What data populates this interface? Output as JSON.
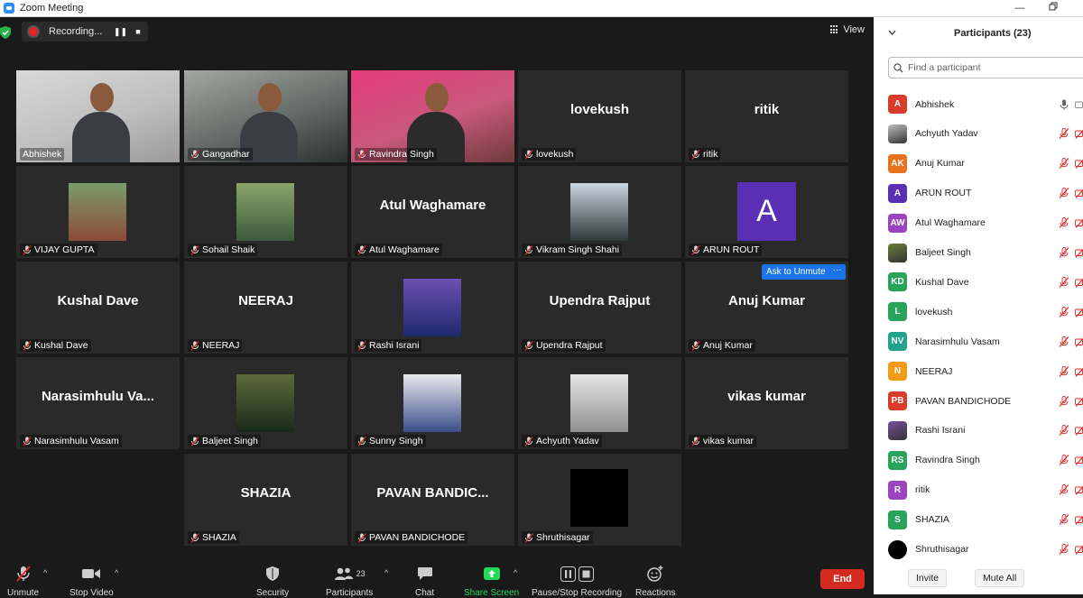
{
  "window": {
    "title": "Zoom Meeting"
  },
  "recording": {
    "label": "Recording..."
  },
  "view": {
    "label": "View"
  },
  "colors": {
    "active_speaker": "#c5e35a",
    "end_red": "#d52b1e",
    "accent_blue": "#1a73e8",
    "share_green": "#23d959"
  },
  "tiles": [
    {
      "caption": "Abhishek",
      "big": "",
      "kind": "photo",
      "muted": false,
      "active": true
    },
    {
      "caption": "Gangadhar",
      "big": "",
      "kind": "photo",
      "muted": true,
      "active": false
    },
    {
      "caption": "Ravindra Singh",
      "big": "",
      "kind": "photo",
      "muted": true,
      "active": false
    },
    {
      "caption": "lovekush",
      "big": "lovekush",
      "kind": "name",
      "muted": true,
      "active": false
    },
    {
      "caption": "ritik",
      "big": "ritik",
      "kind": "name",
      "muted": true,
      "active": false
    },
    {
      "caption": "VIJAY GUPTA",
      "big": "",
      "kind": "thumb",
      "muted": true,
      "active": false
    },
    {
      "caption": "Sohail Shaik",
      "big": "",
      "kind": "thumb",
      "muted": true,
      "active": false
    },
    {
      "caption": "Atul Waghamare",
      "big": "Atul Waghamare",
      "kind": "name",
      "muted": true,
      "active": false
    },
    {
      "caption": "Vikram Singh Shahi",
      "big": "",
      "kind": "thumb",
      "muted": true,
      "active": false
    },
    {
      "caption": "ARUN ROUT",
      "big": "A",
      "kind": "avatar",
      "muted": true,
      "active": false
    },
    {
      "caption": "Kushal Dave",
      "big": "Kushal Dave",
      "kind": "name",
      "muted": true,
      "active": false
    },
    {
      "caption": "NEERAJ",
      "big": "NEERAJ",
      "kind": "name",
      "muted": true,
      "active": false
    },
    {
      "caption": "Rashi Israni",
      "big": "",
      "kind": "thumb",
      "muted": true,
      "active": false
    },
    {
      "caption": "Upendra Rajput",
      "big": "Upendra Rajput",
      "kind": "name",
      "muted": true,
      "active": false
    },
    {
      "caption": "Anuj Kumar",
      "big": "Anuj Kumar",
      "kind": "name",
      "muted": true,
      "active": false,
      "hover": true
    },
    {
      "caption": "Narasimhulu Vasam",
      "big": "Narasimhulu  Va...",
      "kind": "name",
      "muted": true,
      "active": false
    },
    {
      "caption": "Baljeet Singh",
      "big": "",
      "kind": "thumb",
      "muted": true,
      "active": false
    },
    {
      "caption": "Sunny Singh",
      "big": "",
      "kind": "thumb",
      "muted": true,
      "active": false
    },
    {
      "caption": "Achyuth Yadav",
      "big": "",
      "kind": "thumb",
      "muted": true,
      "active": false
    },
    {
      "caption": "vikas kumar",
      "big": "vikas kumar",
      "kind": "name",
      "muted": true,
      "active": false
    },
    {
      "caption": "SHAZIA",
      "big": "SHAZIA",
      "kind": "name",
      "muted": true,
      "active": false
    },
    {
      "caption": "PAVAN BANDICHODE",
      "big": "PAVAN  BANDIC...",
      "kind": "name",
      "muted": true,
      "active": false
    },
    {
      "caption": "Shruthisagar",
      "big": "",
      "kind": "black",
      "muted": true,
      "active": false
    }
  ],
  "hover_actions": {
    "ask_unmute": "Ask to Unmute",
    "more": "···"
  },
  "toolbar": {
    "unmute": "Unmute",
    "stop_video": "Stop Video",
    "security": "Security",
    "participants": "Participants",
    "participants_count": "23",
    "chat": "Chat",
    "share_screen": "Share Screen",
    "pause_stop_recording": "Pause/Stop Recording",
    "reactions": "Reactions",
    "end": "End"
  },
  "panel": {
    "title": "Participants (23)",
    "search_placeholder": "Find a participant",
    "participants": [
      {
        "name": "Abhishek",
        "initials": "A",
        "color": "#d93b2b",
        "photo": false,
        "mic": "on"
      },
      {
        "name": "Achyuth Yadav",
        "initials": "",
        "color": "#bdbdbd",
        "photo": true,
        "mic": "muted"
      },
      {
        "name": "Anuj Kumar",
        "initials": "AK",
        "color": "#e8711d",
        "photo": false,
        "mic": "muted"
      },
      {
        "name": "ARUN ROUT",
        "initials": "A",
        "color": "#5b2fb5",
        "photo": false,
        "mic": "muted"
      },
      {
        "name": "Atul Waghamare",
        "initials": "AW",
        "color": "#9c44c0",
        "photo": false,
        "mic": "muted"
      },
      {
        "name": "Baljeet Singh",
        "initials": "",
        "color": "#6b7d3a",
        "photo": true,
        "mic": "muted"
      },
      {
        "name": "Kushal Dave",
        "initials": "KD",
        "color": "#27a35a",
        "photo": false,
        "mic": "muted"
      },
      {
        "name": "lovekush",
        "initials": "L",
        "color": "#27a35a",
        "photo": false,
        "mic": "muted"
      },
      {
        "name": "Narasimhulu Vasam",
        "initials": "NV",
        "color": "#1fa38a",
        "photo": false,
        "mic": "muted"
      },
      {
        "name": "NEERAJ",
        "initials": "N",
        "color": "#f29b16",
        "photo": false,
        "mic": "muted"
      },
      {
        "name": "PAVAN BANDICHODE",
        "initials": "PB",
        "color": "#d93b2b",
        "photo": false,
        "mic": "muted"
      },
      {
        "name": "Rashi Israni",
        "initials": "",
        "color": "#7a4fa0",
        "photo": true,
        "mic": "muted"
      },
      {
        "name": "Ravindra Singh",
        "initials": "RS",
        "color": "#27a35a",
        "photo": false,
        "mic": "muted"
      },
      {
        "name": "ritik",
        "initials": "R",
        "color": "#9c44c0",
        "photo": false,
        "mic": "muted"
      },
      {
        "name": "SHAZIA",
        "initials": "S",
        "color": "#27a35a",
        "photo": false,
        "mic": "muted"
      },
      {
        "name": "Shruthisagar",
        "initials": "",
        "color": "#000000",
        "photo": false,
        "mic": "muted"
      }
    ],
    "invite": "Invite",
    "mute_all": "Mute All"
  }
}
